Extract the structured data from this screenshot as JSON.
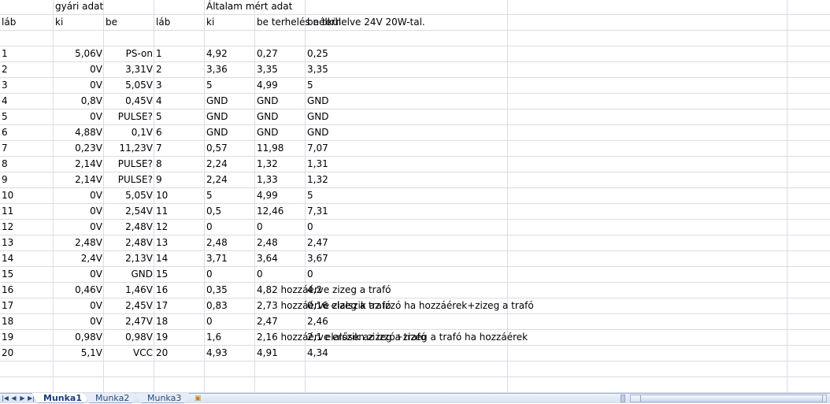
{
  "header_row1": {
    "a": "gyári adat",
    "b": "Általam mért adat"
  },
  "header_row2": {
    "c0": "láb",
    "c1": "ki",
    "c2": "be",
    "c3": "láb",
    "c4": "ki",
    "c5": "be terhelés nélkül",
    "c6": "be terhelve 24V 20W-tal."
  },
  "rows": [
    [
      "1",
      "5,06V",
      "PS-on",
      "1",
      "4,92",
      "0,27",
      "0,25"
    ],
    [
      "2",
      "0V",
      "3,31V",
      "2",
      "3,36",
      "3,35",
      "3,35"
    ],
    [
      "3",
      "0V",
      "5,05V",
      "3",
      "5",
      "4,99",
      "5"
    ],
    [
      "4",
      "0,8V",
      "0,45V",
      "4",
      "GND",
      "GND",
      "GND"
    ],
    [
      "5",
      "0V",
      "PULSE?",
      "5",
      "GND",
      "GND",
      "GND"
    ],
    [
      "6",
      "4,88V",
      "0,1V",
      "6",
      "GND",
      "GND",
      "GND"
    ],
    [
      "7",
      "0,23V",
      "11,23V",
      "7",
      "0,57",
      "11,98",
      "7,07"
    ],
    [
      "8",
      "2,14V",
      "PULSE?",
      "8",
      "2,24",
      "1,32",
      "1,31"
    ],
    [
      "9",
      "2,14V",
      "PULSE?",
      "9",
      "2,24",
      "1,33",
      "1,32"
    ],
    [
      "10",
      "0V",
      "5,05V",
      "10",
      "5",
      "4,99",
      "5"
    ],
    [
      "11",
      "0V",
      "2,54V",
      "11",
      "0,5",
      "12,46",
      "7,31"
    ],
    [
      "12",
      "0V",
      "2,48V",
      "12",
      "0",
      "0",
      "0"
    ],
    [
      "13",
      "2,48V",
      "2,48V",
      "13",
      "2,48",
      "2,48",
      "2,47"
    ],
    [
      "14",
      "2,4V",
      "2,13V",
      "14",
      "3,71",
      "3,64",
      "3,67"
    ],
    [
      "15",
      "0V",
      "GND",
      "15",
      "0",
      "0",
      "0"
    ],
    [
      "16",
      "0,46V",
      "1,46V",
      "16",
      "0,35",
      "4,82 hozzáérve zizeg a trafó",
      "4,2"
    ],
    [
      "17",
      "0V",
      "2,45V",
      "17",
      "0,83",
      "2,73 hozzáérve zizeg a trafó",
      "0,16 elalszik az izzó ha hozzáérek+zizeg a trafó"
    ],
    [
      "18",
      "0V",
      "2,47V",
      "18",
      "0",
      "2,47",
      "2,46"
    ],
    [
      "19",
      "0,98V",
      "0,98V",
      "19",
      "1,6",
      "2,16 hozzáérve erősen zizeg a trafó",
      "2,1 elalszik az izzó+zizeg a trafó ha hozzáérek"
    ],
    [
      "20",
      "5,1V",
      "VCC",
      "20",
      "4,93",
      "4,91",
      "4,34"
    ]
  ],
  "tabs": [
    "Munka1",
    "Munka2",
    "Munka3"
  ],
  "active_tab": "Munka1",
  "colors": {
    "grid": "#d9dde6",
    "tabbar": "#dce6f4",
    "tab_text": "#2b4a78"
  }
}
